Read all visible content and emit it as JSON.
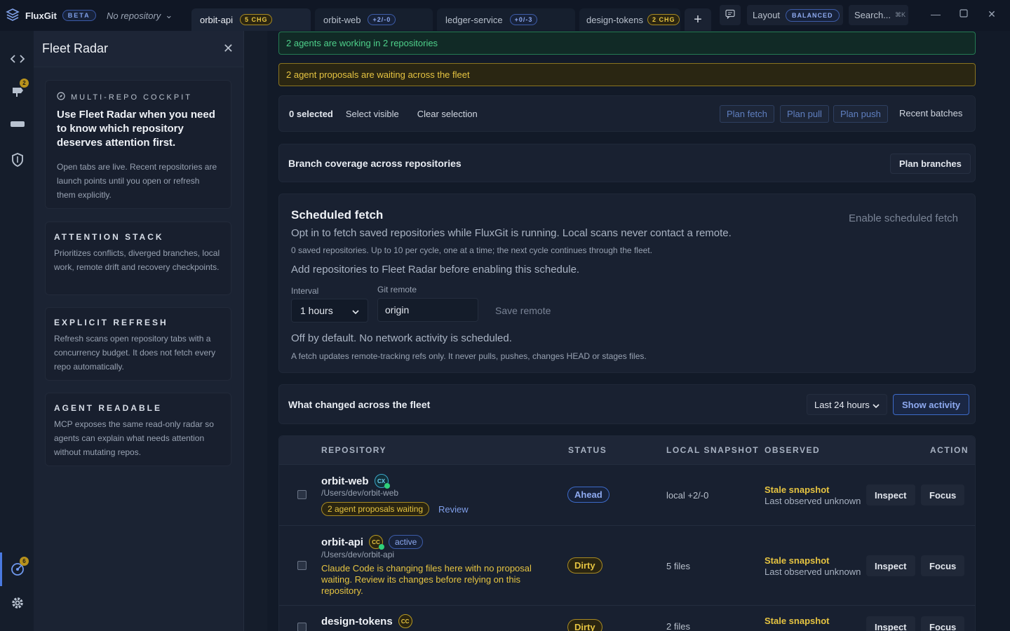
{
  "app": {
    "name": "FluxGit",
    "badge": "BETA",
    "repo_picker": "No repository"
  },
  "tabs": [
    {
      "label": "orbit-api",
      "badge": "5 CHG"
    },
    {
      "label": "orbit-web",
      "badge": "+2/-0"
    },
    {
      "label": "ledger-service",
      "badge": "+0/-3"
    },
    {
      "label": "design-tokens",
      "badge": "2 CHG"
    }
  ],
  "toolbar": {
    "layout_label": "Layout",
    "layout_value": "BALANCED",
    "search_label": "Search...",
    "search_shortcut": "⌘K"
  },
  "rail": {
    "agents_badge": "2",
    "radar_badge": "6"
  },
  "panel": {
    "title": "Fleet Radar",
    "intro": {
      "eyebrow": "MULTI-REPO COCKPIT",
      "heading": "Use Fleet Radar when you need to know which repository deserves attention first.",
      "body": "Open tabs are live. Recent repositories are launch points until you open or refresh them explicitly."
    },
    "cards": [
      {
        "title": "ATTENTION STACK",
        "body": "Prioritizes conflicts, diverged branches, local work, remote drift and recovery checkpoints."
      },
      {
        "title": "EXPLICIT REFRESH",
        "body": "Refresh scans open repository tabs with a concurrency budget. It does not fetch every repo automatically."
      },
      {
        "title": "AGENT READABLE",
        "body": "MCP exposes the same read-only radar so agents can explain what needs attention without mutating repos."
      }
    ]
  },
  "banners": {
    "working": "2 agents are working in 2 repositories",
    "proposals": "2 agent proposals are waiting across the fleet"
  },
  "selection": {
    "count": "0 selected",
    "select_visible": "Select visible",
    "clear": "Clear selection",
    "plan_fetch": "Plan fetch",
    "plan_pull": "Plan pull",
    "plan_push": "Plan push",
    "recent_batches": "Recent batches"
  },
  "branches": {
    "title": "Branch coverage across repositories",
    "button": "Plan branches"
  },
  "schedule": {
    "title": "Scheduled fetch",
    "enable": "Enable scheduled fetch",
    "desc": "Opt in to fetch saved repositories while FluxGit is running. Local scans never contact a remote.",
    "detail": "0 saved repositories. Up to 10 per cycle, one at a time; the next cycle continues through the fleet.",
    "hint": "Add repositories to Fleet Radar before enabling this schedule.",
    "interval_label": "Interval",
    "interval_value": "1 hours",
    "remote_label": "Git remote",
    "remote_value": "origin",
    "save_remote": "Save remote",
    "off_note": "Off by default. No network activity is scheduled.",
    "fetch_note": "A fetch updates remote-tracking refs only. It never pulls, pushes, changes HEAD or stages files."
  },
  "activity": {
    "title": "What changed across the fleet",
    "range": "Last 24 hours",
    "button": "Show activity"
  },
  "table": {
    "headers": {
      "repository": "REPOSITORY",
      "status": "STATUS",
      "snapshot": "LOCAL SNAPSHOT",
      "observed": "OBSERVED",
      "action": "ACTION"
    },
    "rows": [
      {
        "name": "orbit-web",
        "agent": "CX",
        "path": "/Users/dev/orbit-web",
        "chip": "2 agent proposals waiting",
        "review": "Review",
        "status": "Ahead",
        "snapshot": "local +2/-0",
        "observed": "Stale snapshot",
        "observed_sub": "Last observed unknown",
        "inspect": "Inspect",
        "focus": "Focus"
      },
      {
        "name": "orbit-api",
        "agent": "CC",
        "active": "active",
        "path": "/Users/dev/orbit-api",
        "warning": "Claude Code is changing files here with no proposal waiting. Review its changes before relying on this repository.",
        "status": "Dirty",
        "snapshot": "5 files",
        "observed": "Stale snapshot",
        "observed_sub": "Last observed unknown",
        "inspect": "Inspect",
        "focus": "Focus"
      },
      {
        "name": "design-tokens",
        "agent": "CC",
        "status": "Dirty",
        "snapshot": "2 files",
        "observed": "Stale snapshot",
        "inspect": "Inspect",
        "focus": "Focus"
      }
    ]
  }
}
